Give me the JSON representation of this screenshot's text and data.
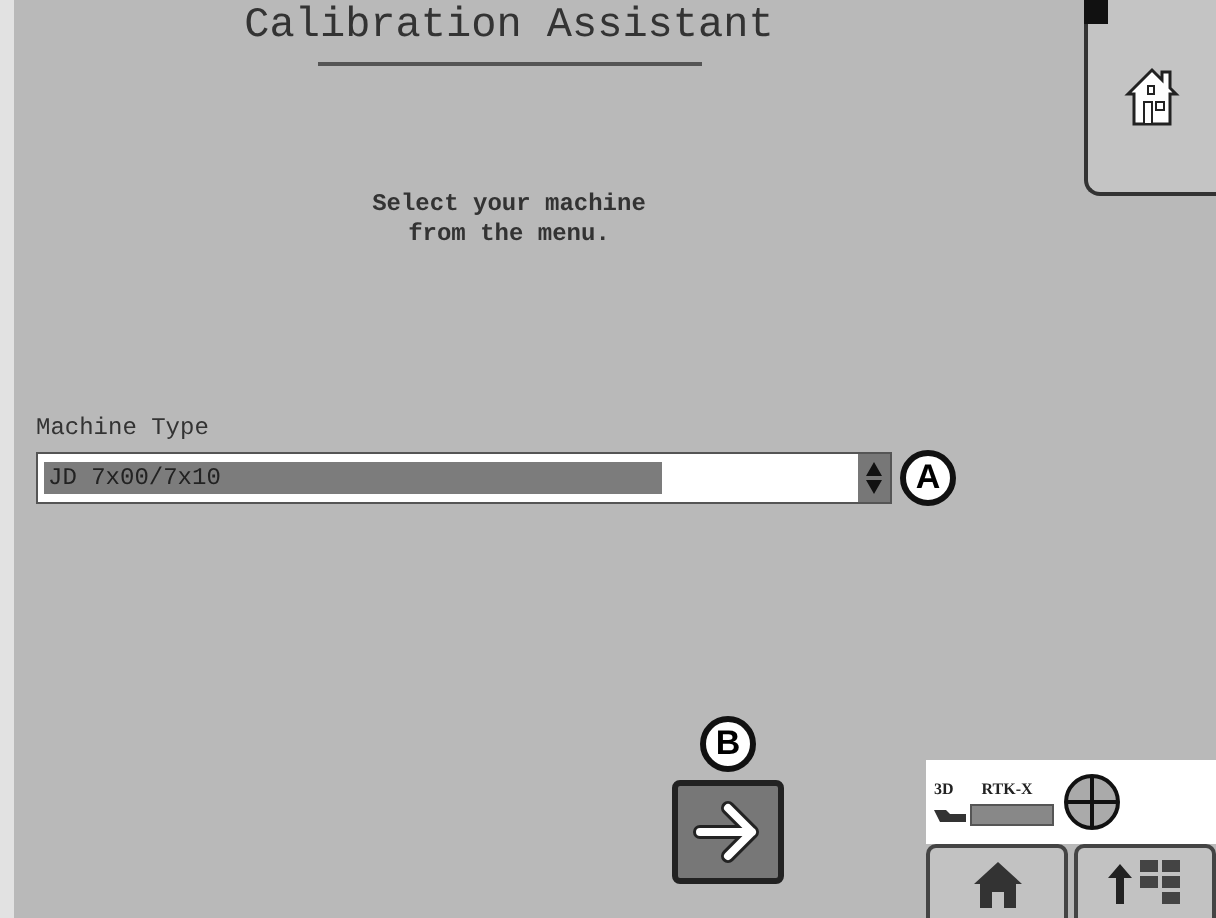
{
  "title": "Calibration Assistant",
  "instruction": "Select your machine\nfrom the menu.",
  "machine_type": {
    "label": "Machine Type",
    "value": "JD 7x00/7x10",
    "callout": "A"
  },
  "next_button": {
    "callout": "B"
  },
  "status": {
    "mode": "3D",
    "correction": "RTK-X"
  }
}
